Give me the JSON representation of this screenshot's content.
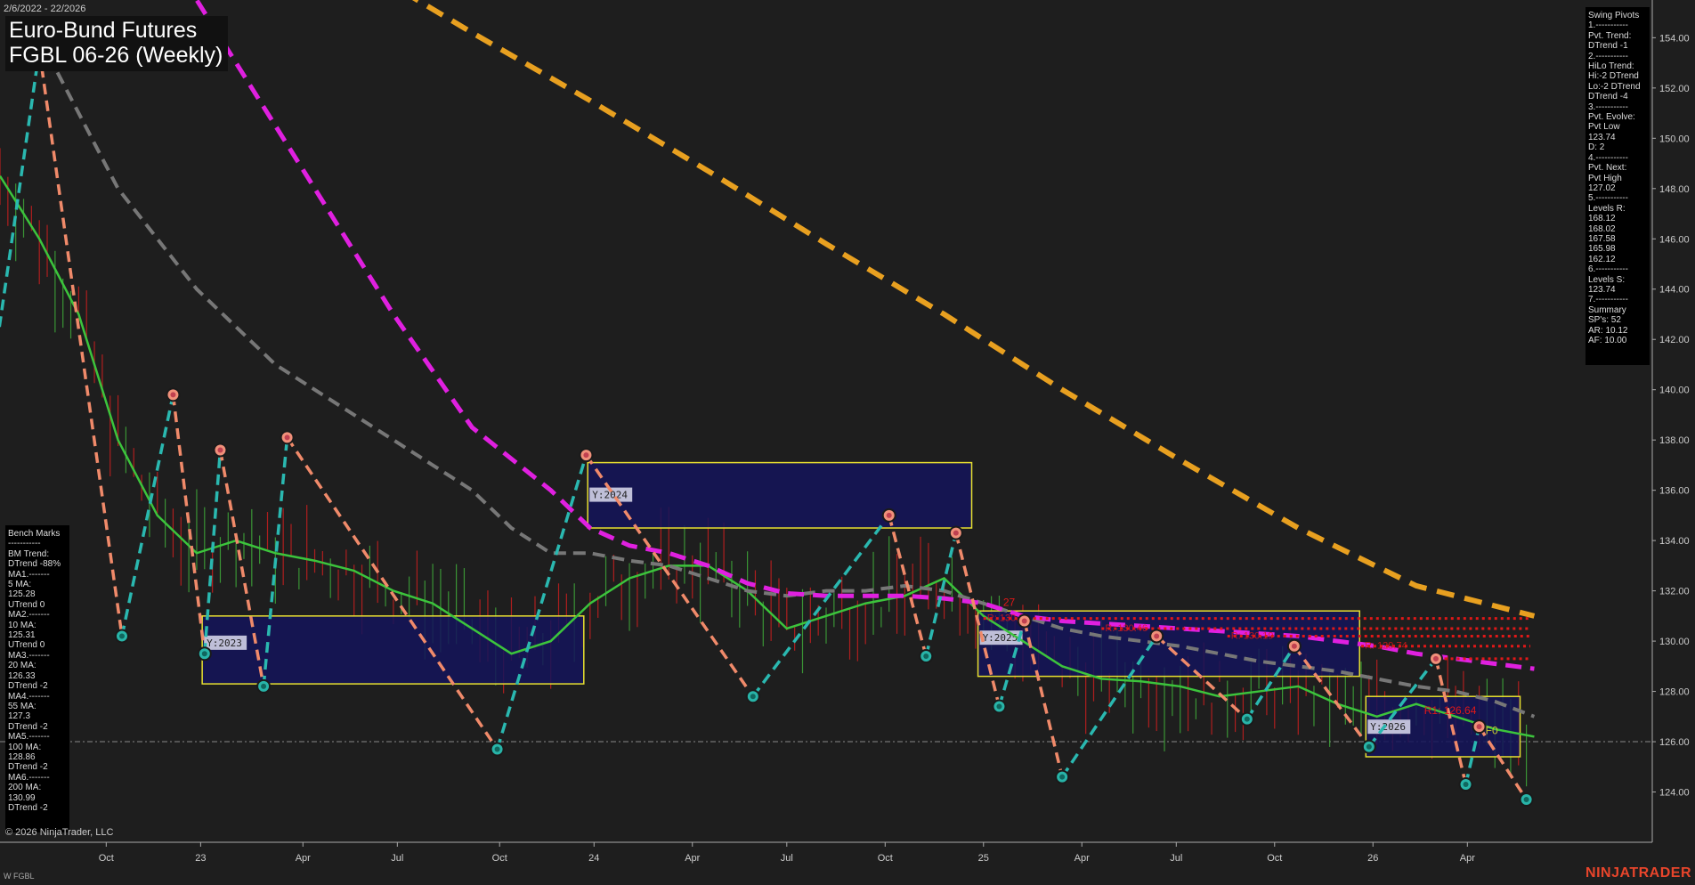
{
  "header": {
    "date_range": "2/6/2022 - 22/2026",
    "title_line1": "Euro-Bund Futures",
    "title_line2": "FGBL 06-26 (Weekly)"
  },
  "swing_panel": {
    "lines": [
      "Swing Pivots",
      "1.-----------",
      "Pvt. Trend:",
      "DTrend -1",
      "2.-----------",
      "HiLo Trend:",
      "Hi:-2 DTrend",
      "Lo:-2 DTrend",
      "DTrend -4",
      "3.-----------",
      "Pvt. Evolve:",
      "Pvt Low",
      "123.74",
      "D: 2",
      "4.-----------",
      "Pvt. Next:",
      "Pvt High",
      "127.02",
      "5.-----------",
      "Levels R:",
      "168.12",
      "168.02",
      "167.58",
      "165.98",
      "162.12",
      "6.-----------",
      "Levels S:",
      "123.74",
      "7.-----------",
      "Summary",
      "SP's: 52",
      "AR: 10.12",
      "AF: 10.00"
    ]
  },
  "bench_panel": {
    "lines": [
      "Bench Marks",
      "-----------",
      "BM Trend:",
      "DTrend -88%",
      "MA1.-------",
      "5 MA:",
      "125.28",
      "UTrend 0",
      "MA2.-------",
      "10 MA:",
      "125.31",
      "UTrend 0",
      "MA3.-------",
      "20 MA:",
      "126.33",
      "DTrend -2",
      "MA4.-------",
      "55 MA:",
      "127.3",
      "DTrend -2",
      "MA5.-------",
      "100 MA:",
      "128.86",
      "DTrend -2",
      "MA6.-------",
      "200 MA:",
      "130.99",
      "DTrend -2"
    ]
  },
  "footer": {
    "copyright": "© 2026 NinjaTrader, LLC",
    "symbol": "W FGBL",
    "brand": "NINJATRADER"
  },
  "colors": {
    "background": "#1e1e1e",
    "up_bar": "#3fa93a",
    "down_bar": "#c81e1e",
    "ma_green": "#3cc43c",
    "ma_gray": "#777777",
    "ma_magenta": "#e020e0",
    "ma_orange": "#e8a020",
    "swing_up": "#2ab8b0",
    "swing_down": "#f08a6a",
    "box_fill": "#14145a",
    "box_border": "#e8e030",
    "resistance": "#e01818"
  },
  "chart_data": {
    "type": "line",
    "title": "Euro-Bund Futures FGBL 06-26 (Weekly)",
    "ylim": [
      122.0,
      155.5
    ],
    "xlim": [
      0,
      210
    ],
    "y_ticks": [
      124.0,
      126.0,
      128.0,
      130.0,
      132.0,
      134.0,
      136.0,
      138.0,
      140.0,
      142.0,
      144.0,
      146.0,
      148.0,
      150.0,
      152.0,
      154.0
    ],
    "x_ticks": [
      {
        "x": 13.5,
        "label": "Oct"
      },
      {
        "x": 25.5,
        "label": "23"
      },
      {
        "x": 38.5,
        "label": "Apr"
      },
      {
        "x": 50.5,
        "label": "Jul"
      },
      {
        "x": 63.5,
        "label": "Oct"
      },
      {
        "x": 75.5,
        "label": "24"
      },
      {
        "x": 88,
        "label": "Apr"
      },
      {
        "x": 100,
        "label": "Jul"
      },
      {
        "x": 112.5,
        "label": "Oct"
      },
      {
        "x": 125,
        "label": "25"
      },
      {
        "x": 137.5,
        "label": "Apr"
      },
      {
        "x": 149.5,
        "label": "Jul"
      },
      {
        "x": 162,
        "label": "Oct"
      },
      {
        "x": 174.5,
        "label": "26"
      },
      {
        "x": 186.5,
        "label": "Apr"
      }
    ],
    "current_price_line": 126.0,
    "swing_pivots": [
      {
        "x": -1,
        "y": 140.5
      },
      {
        "x": 5,
        "y": 153.5
      },
      {
        "x": 15.5,
        "y": 130.2
      },
      {
        "x": 22,
        "y": 139.8
      },
      {
        "x": 26,
        "y": 129.5
      },
      {
        "x": 28,
        "y": 137.6
      },
      {
        "x": 33.5,
        "y": 128.2
      },
      {
        "x": 36.5,
        "y": 138.1
      },
      {
        "x": 63.2,
        "y": 125.7
      },
      {
        "x": 74.5,
        "y": 137.4
      },
      {
        "x": 95.7,
        "y": 127.8
      },
      {
        "x": 113,
        "y": 135.0
      },
      {
        "x": 117.7,
        "y": 129.4
      },
      {
        "x": 121.5,
        "y": 134.3
      },
      {
        "x": 127,
        "y": 127.4
      },
      {
        "x": 130.2,
        "y": 130.8
      },
      {
        "x": 135,
        "y": 124.6
      },
      {
        "x": 147,
        "y": 130.2
      },
      {
        "x": 158.5,
        "y": 126.9
      },
      {
        "x": 164.5,
        "y": 129.8
      },
      {
        "x": 174,
        "y": 125.8
      },
      {
        "x": 182.5,
        "y": 129.3
      },
      {
        "x": 186.3,
        "y": 124.3
      },
      {
        "x": 188,
        "y": 126.6
      },
      {
        "x": 194,
        "y": 123.7
      }
    ],
    "series": [
      {
        "x": [
          0,
          5,
          10,
          15,
          20,
          25,
          30,
          35,
          40,
          45,
          50,
          55,
          60,
          65,
          70,
          75,
          80,
          85,
          90,
          95,
          100,
          105,
          110,
          115,
          120,
          125,
          130,
          135,
          140,
          145,
          150,
          155,
          160,
          165,
          170,
          175,
          180,
          185,
          190,
          195
        ],
        "values": [
          148.5,
          146,
          143,
          138,
          135,
          133.5,
          134,
          133.5,
          133.2,
          132.8,
          132,
          131.5,
          130.5,
          129.5,
          130,
          131.5,
          132.5,
          133,
          133,
          132,
          130.5,
          131,
          131.5,
          131.8,
          132.5,
          131,
          130,
          129,
          128.5,
          128.4,
          128.2,
          127.8,
          128,
          128.2,
          127.5,
          127,
          127.5,
          127,
          126.5,
          126.2
        ]
      },
      {
        "x": [
          5,
          10,
          15,
          20,
          25,
          30,
          35,
          40,
          45,
          50,
          55,
          60,
          65,
          70,
          75,
          80,
          85,
          90,
          95,
          100,
          105,
          110,
          115,
          120,
          125,
          130,
          135,
          140,
          145,
          150,
          155,
          160,
          165,
          170,
          175,
          180,
          185,
          190,
          195
        ],
        "values": [
          154,
          151,
          148,
          146,
          144,
          142.5,
          141,
          140,
          139,
          138,
          137,
          136,
          134.5,
          133.5,
          133.5,
          133.2,
          133,
          132.5,
          132,
          131.8,
          132,
          132,
          132.2,
          132,
          131.5,
          131,
          130.5,
          130.2,
          130,
          129.8,
          129.5,
          129.2,
          129,
          128.8,
          128.5,
          128.2,
          128,
          127.6,
          127
        ]
      },
      {
        "x": [
          20,
          30,
          40,
          50,
          60,
          70,
          75,
          80,
          85,
          90,
          95,
          100,
          105,
          110,
          115,
          120,
          125,
          130,
          135,
          140,
          145,
          150,
          155,
          160,
          165,
          170,
          175,
          180,
          185,
          190,
          195
        ],
        "values": [
          158,
          153,
          148,
          143,
          138.5,
          136,
          134.5,
          133.8,
          133.5,
          133,
          132.3,
          131.9,
          131.8,
          131.8,
          131.8,
          131.7,
          131.5,
          131,
          130.8,
          130.7,
          130.6,
          130.5,
          130.4,
          130.3,
          130.2,
          130,
          129.8,
          129.5,
          129.3,
          129.1,
          128.9
        ]
      },
      {
        "x": [
          45,
          60,
          75,
          90,
          105,
          120,
          135,
          150,
          165,
          180,
          195
        ],
        "values": [
          157,
          154.2,
          151.5,
          148.7,
          145.8,
          143,
          140,
          137.2,
          134.5,
          132.2,
          131
        ]
      }
    ],
    "boxes": [
      {
        "label": "Y:2023",
        "x0": 25.7,
        "x1": 74.2,
        "y0": 128.3,
        "y1": 131.0
      },
      {
        "label": "Y:2024",
        "x0": 74.7,
        "x1": 123.5,
        "y0": 134.5,
        "y1": 137.1
      },
      {
        "label": "Y:2025",
        "x0": 124.3,
        "x1": 172.8,
        "y0": 128.6,
        "y1": 131.2
      },
      {
        "label": "Y:2026",
        "x0": 173.6,
        "x1": 193.2,
        "y0": 125.4,
        "y1": 127.8
      }
    ],
    "resistance_levels": [
      {
        "y": 130.9,
        "x0": 125,
        "label": "R: 130.81"
      },
      {
        "y": 130.5,
        "x0": 140,
        "label": "R: 130.46"
      },
      {
        "y": 130.2,
        "x0": 156,
        "label": "R: 130.19"
      },
      {
        "y": 129.8,
        "x0": 173,
        "label": "R: 129.74"
      },
      {
        "y": 129.3,
        "x0": 182,
        "label": ""
      }
    ],
    "annotations": [
      {
        "text": "R1: 126.64",
        "x": 181,
        "y": 127.1,
        "color": "#e01818"
      },
      {
        "text": "F0",
        "x": 188.8,
        "y": 126.3,
        "color": "#c8c830"
      },
      {
        "text": "27",
        "x": 127.5,
        "y": 131.4,
        "color": "#e01818"
      }
    ]
  }
}
